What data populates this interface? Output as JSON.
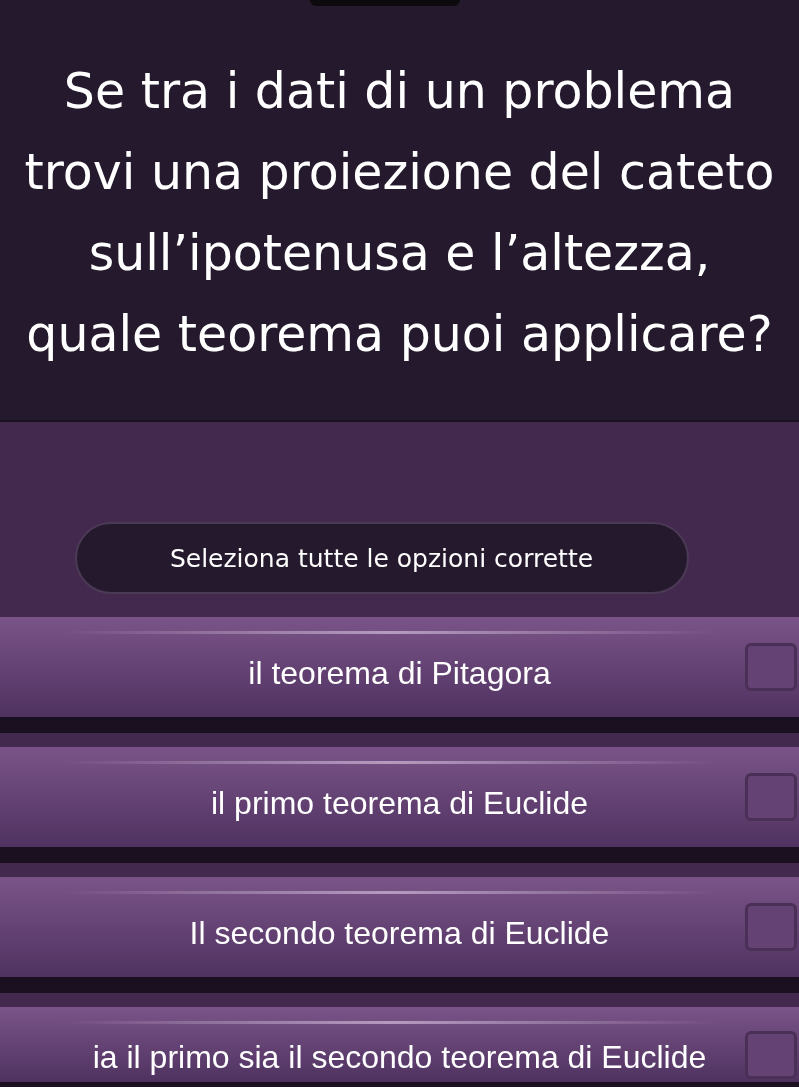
{
  "question": "Se tra i dati di un problema trovi una proiezione del cateto sull’ipotenusa e l’altezza, quale teorema puoi applicare?",
  "instruction": "Seleziona tutte le opzioni corrette",
  "options": [
    {
      "label": "il teorema di Pitagora",
      "checked": false
    },
    {
      "label": "il primo teorema di Euclide",
      "checked": false
    },
    {
      "label": "Il secondo teorema di Euclide",
      "checked": false
    },
    {
      "label": "ia il primo sia il secondo teorema di Euclide",
      "checked": false
    }
  ]
}
